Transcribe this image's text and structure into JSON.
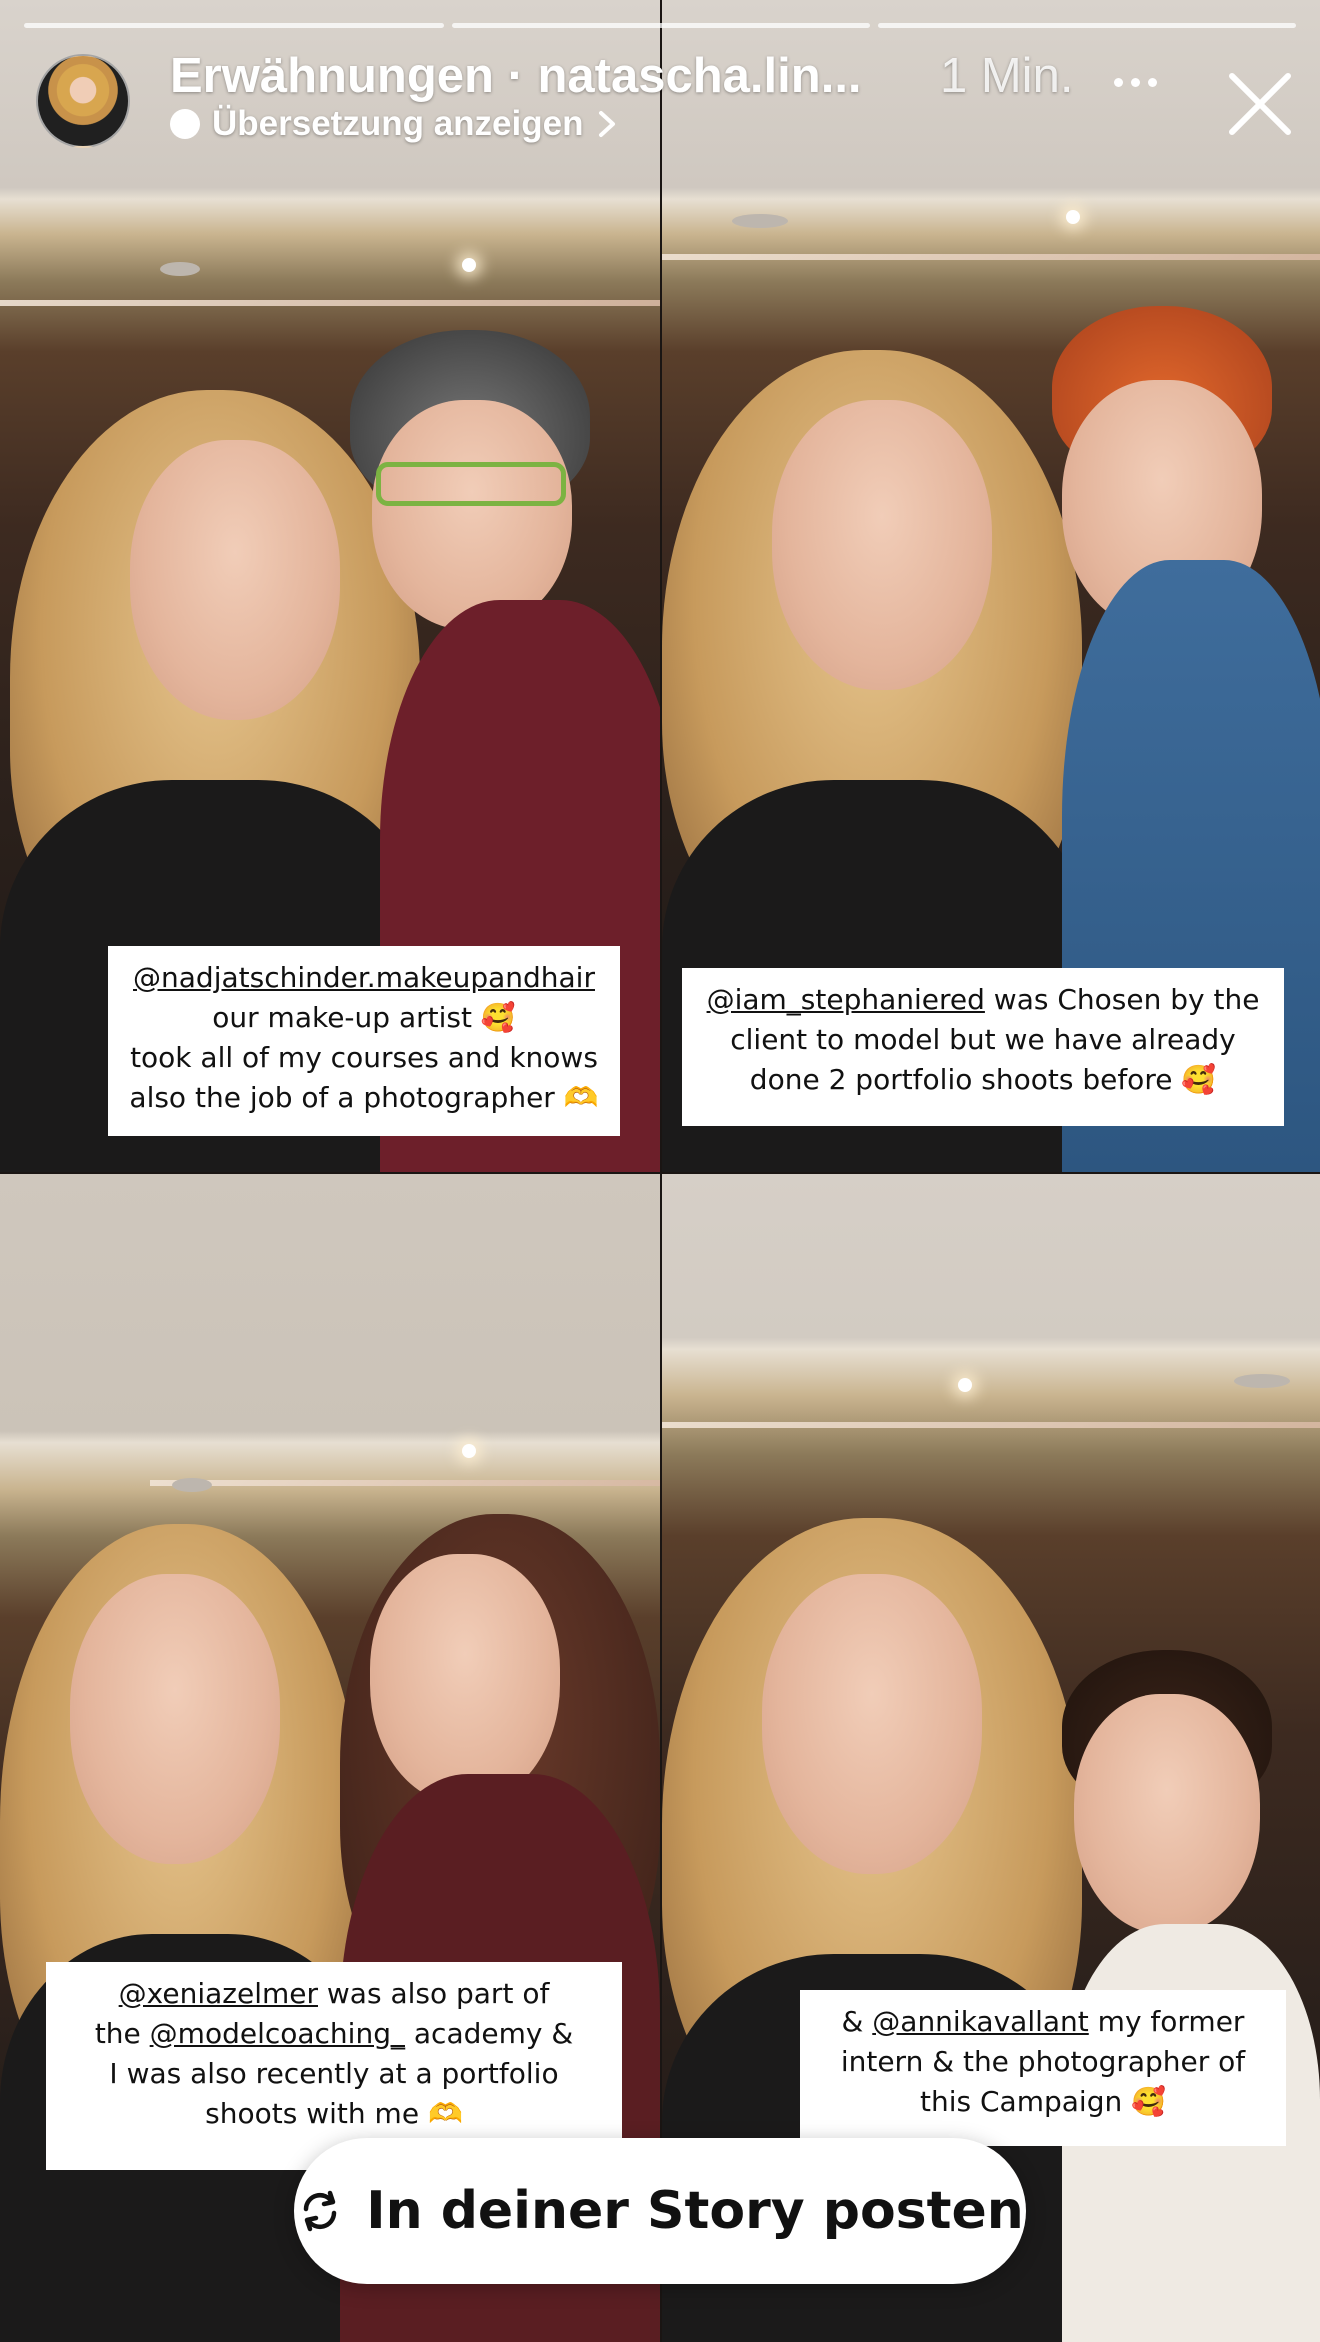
{
  "header": {
    "title": "Erwähnungen · natascha.lin...",
    "time": "1 Min.",
    "translate_label": "Übersetzung anzeigen",
    "more_icon": "more-dots-icon",
    "close_icon": "close-icon"
  },
  "progress": {
    "segments": 3
  },
  "tiles": [
    {
      "caption": {
        "mention": "@nadjatschinder.makeupandhair",
        "line2": "our make-up artist 🥰",
        "line3": "took all of my courses and knows",
        "line4": "also the job of a photographer 🫶"
      }
    },
    {
      "caption": {
        "mention": "@iam_stephaniered",
        "line1_rest": " was Chosen by the",
        "line2": "client to model but we have already",
        "line3": "done 2 portfolio shoots before 🥰"
      }
    },
    {
      "caption": {
        "mention": "@xeniazelmer",
        "line1_rest": " was also part of",
        "line2_pre": "the ",
        "mention2": "@modelcoaching_",
        "line2_rest": " academy &",
        "line3": "I was also recently at a portfolio",
        "line4": "shoots with me 🫶"
      }
    },
    {
      "caption": {
        "line1_pre": "& ",
        "mention": "@annikavallant",
        "line1_rest": " my former",
        "line2": "intern & the photographer of",
        "line3": "this Campaign 🥰"
      }
    }
  ],
  "footer": {
    "share_label": "In deiner Story posten",
    "share_icon": "repost-icon"
  },
  "colors": {
    "caption_bg": "#ffffff",
    "text_light": "#ffffff",
    "button_bg": "#ffffff"
  }
}
